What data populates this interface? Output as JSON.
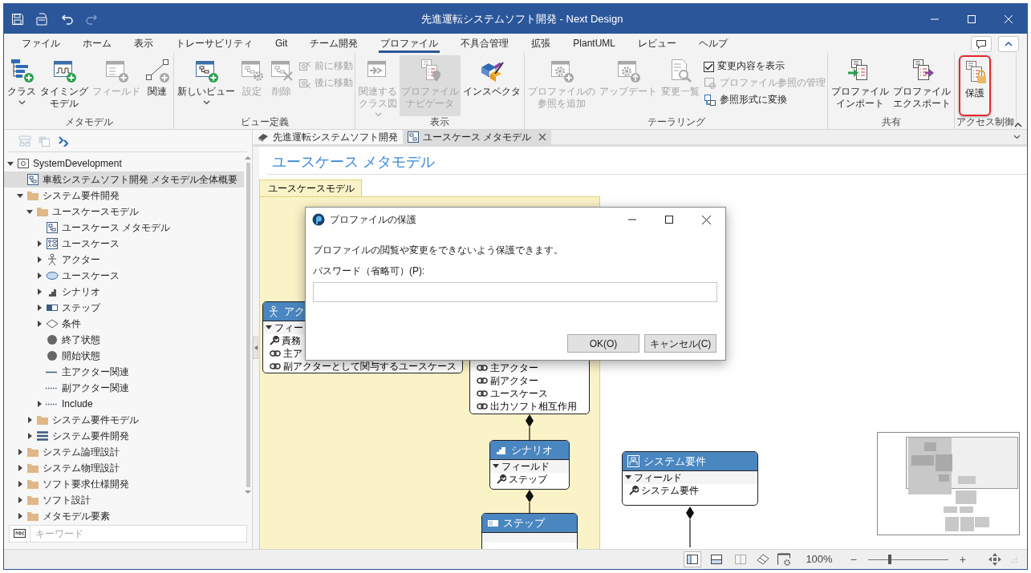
{
  "window": {
    "title": "先進運転システムソフト開発 - Next Design"
  },
  "menu_tabs": [
    {
      "label": "ファイル",
      "selected": false
    },
    {
      "label": "ホーム",
      "selected": false
    },
    {
      "label": "表示",
      "selected": false
    },
    {
      "label": "トレーサビリティ",
      "selected": false
    },
    {
      "label": "Git",
      "selected": false
    },
    {
      "label": "チーム開発",
      "selected": false
    },
    {
      "label": "プロファイル",
      "selected": true
    },
    {
      "label": "不具合管理",
      "selected": false
    },
    {
      "label": "拡張",
      "selected": false
    },
    {
      "label": "PlantUML",
      "selected": false
    },
    {
      "label": "レビュー",
      "selected": false
    },
    {
      "label": "ヘルプ",
      "selected": false
    }
  ],
  "ribbon": {
    "groups": [
      {
        "label": "メタモデル",
        "items": [
          {
            "kind": "large",
            "label": "クラス",
            "dropdown": true,
            "disabled": false
          },
          {
            "kind": "large",
            "lines": [
              "タイミング",
              "モデル"
            ],
            "disabled": false
          },
          {
            "kind": "large",
            "label": "フィールド",
            "disabled": true
          },
          {
            "kind": "large",
            "label": "関連",
            "disabled": false
          }
        ]
      },
      {
        "label": "ビュー定義",
        "items": [
          {
            "kind": "large",
            "label": "新しいビュー",
            "dropdown": true,
            "disabled": false
          },
          {
            "kind": "large",
            "label": "設定",
            "disabled": true
          },
          {
            "kind": "large",
            "label": "削除",
            "disabled": true
          },
          {
            "kind": "small",
            "label": "前に移動",
            "disabled": true
          },
          {
            "kind": "small",
            "label": "後に移動",
            "disabled": true
          }
        ]
      },
      {
        "label": "表示",
        "items": [
          {
            "kind": "large",
            "lines": [
              "関連する",
              "クラス図"
            ],
            "dropdown": true,
            "disabled": true
          },
          {
            "kind": "large",
            "lines": [
              "プロファイル",
              "ナビゲータ"
            ],
            "disabled": true,
            "pressed": true
          },
          {
            "kind": "large",
            "label": "インスペクタ",
            "disabled": false
          }
        ]
      },
      {
        "label": "テーラリング",
        "items": [
          {
            "kind": "large",
            "lines": [
              "プロファイルの",
              "参照を追加"
            ],
            "disabled": true
          },
          {
            "kind": "large",
            "label": "アップデート",
            "disabled": true
          },
          {
            "kind": "large",
            "label": "変更一覧",
            "disabled": true
          },
          {
            "kind": "check",
            "label": "変更内容を表示",
            "checked": true
          },
          {
            "kind": "small",
            "label": "プロファイル参照の管理",
            "disabled": true
          },
          {
            "kind": "small",
            "label": "参照形式に変換",
            "disabled": false
          }
        ]
      },
      {
        "label": "共有",
        "items": [
          {
            "kind": "large",
            "lines": [
              "プロファイル",
              "インポート"
            ],
            "disabled": false
          },
          {
            "kind": "large",
            "lines": [
              "プロファイル",
              "エクスポート"
            ],
            "disabled": false
          }
        ]
      },
      {
        "label": "アクセス制御",
        "items": [
          {
            "kind": "large",
            "label": "保護",
            "disabled": false,
            "highlighted": true
          }
        ]
      }
    ]
  },
  "explorer": {
    "tree": [
      {
        "label": "SystemDevelopment",
        "kind": "project",
        "expanded": true,
        "selected": false,
        "children": [
          {
            "label": "車載システムソフト開発 メタモデル全体概要",
            "kind": "diagram",
            "selected": true
          },
          {
            "label": "システム要件開発",
            "kind": "folder",
            "expanded": true,
            "selected": false,
            "children": [
              {
                "label": "ユースケースモデル",
                "kind": "folder",
                "expanded": true,
                "selected": false,
                "children": [
                  {
                    "label": "ユースケース メタモデル",
                    "kind": "diagram",
                    "selected": false
                  },
                  {
                    "label": "ユースケース",
                    "kind": "usecase-diagram",
                    "expanded": false,
                    "selected": false
                  },
                  {
                    "label": "アクター",
                    "kind": "actor",
                    "expanded": false,
                    "selected": false
                  },
                  {
                    "label": "ユースケース",
                    "kind": "usecase",
                    "expanded": false,
                    "selected": false
                  },
                  {
                    "label": "シナリオ",
                    "kind": "scenario",
                    "expanded": false,
                    "selected": false
                  },
                  {
                    "label": "ステップ",
                    "kind": "step",
                    "expanded": false,
                    "selected": false
                  },
                  {
                    "label": "条件",
                    "kind": "condition",
                    "expanded": false,
                    "selected": false
                  },
                  {
                    "label": "終了状態",
                    "kind": "state",
                    "selected": false
                  },
                  {
                    "label": "開始状態",
                    "kind": "state",
                    "selected": false
                  },
                  {
                    "label": "主アクター関連",
                    "kind": "line",
                    "selected": false
                  },
                  {
                    "label": "副アクター関連",
                    "kind": "dotted",
                    "selected": false
                  },
                  {
                    "label": "Include",
                    "kind": "dotted",
                    "expanded": false,
                    "selected": false
                  }
                ]
              },
              {
                "label": "システム要件モデル",
                "kind": "folder",
                "expanded": false,
                "selected": false
              },
              {
                "label": "システム要件開発",
                "kind": "list",
                "expanded": false,
                "selected": false
              }
            ]
          },
          {
            "label": "システム論理設計",
            "kind": "folder",
            "expanded": false,
            "selected": false
          },
          {
            "label": "システム物理設計",
            "kind": "folder",
            "expanded": false,
            "selected": false
          },
          {
            "label": "ソフト要求仕様開発",
            "kind": "folder",
            "expanded": false,
            "selected": false
          },
          {
            "label": "ソフト設計",
            "kind": "folder",
            "expanded": false,
            "selected": false
          },
          {
            "label": "メタモデル要素",
            "kind": "folder",
            "expanded": false,
            "selected": false
          }
        ]
      }
    ],
    "search": {
      "placeholder": "キーワード"
    }
  },
  "document_tabs": [
    {
      "label": "先進運転システムソフト開発",
      "selected": false,
      "closable": false
    },
    {
      "label": "ユースケース メタモデル",
      "selected": true,
      "closable": true
    }
  ],
  "diagram": {
    "title": "ユースケース メタモデル",
    "frame": {
      "label": "ユースケースモデル"
    },
    "nodes": [
      {
        "kind": "actor",
        "title": "アク",
        "section": "フィー",
        "items": [
          {
            "text": "責務",
            "kind": "property"
          },
          {
            "text": "主ア",
            "kind": "reference"
          },
          {
            "text": "副アクターとして関与するユースケース",
            "kind": "reference"
          }
        ]
      },
      {
        "kind": "usecase",
        "items": [
          {
            "text": "主アクター",
            "kind": "reference"
          },
          {
            "text": "副アクター",
            "kind": "reference"
          },
          {
            "text": "ユースケース",
            "kind": "reference"
          },
          {
            "text": "出力ソフト相互作用",
            "kind": "reference"
          }
        ]
      },
      {
        "kind": "scenario",
        "title": "シナリオ",
        "section": "フィールド",
        "items": [
          {
            "text": "ステップ",
            "kind": "property"
          }
        ]
      },
      {
        "kind": "step",
        "title": "ステップ"
      },
      {
        "kind": "requirement",
        "title": "システム要件",
        "section": "フィールド",
        "items": [
          {
            "text": "システム要件",
            "kind": "property"
          }
        ]
      }
    ]
  },
  "dialog": {
    "title": "プロファイルの保護",
    "message": "プロファイルの閲覧や変更をできないよう保護できます。",
    "field_label": "パスワード（省略可）(P):",
    "buttons": [
      "OK(O)",
      "キャンセル(C)"
    ]
  },
  "status_bar": {
    "layout_buttons": [
      {
        "selected": true,
        "disabled": false
      },
      {
        "selected": false,
        "disabled": false
      },
      {
        "selected": false,
        "disabled": true
      }
    ],
    "zoom": "100%",
    "zoom_out": "−",
    "zoom_in": "+",
    "zoom_slider": {
      "level": 0.27
    }
  }
}
